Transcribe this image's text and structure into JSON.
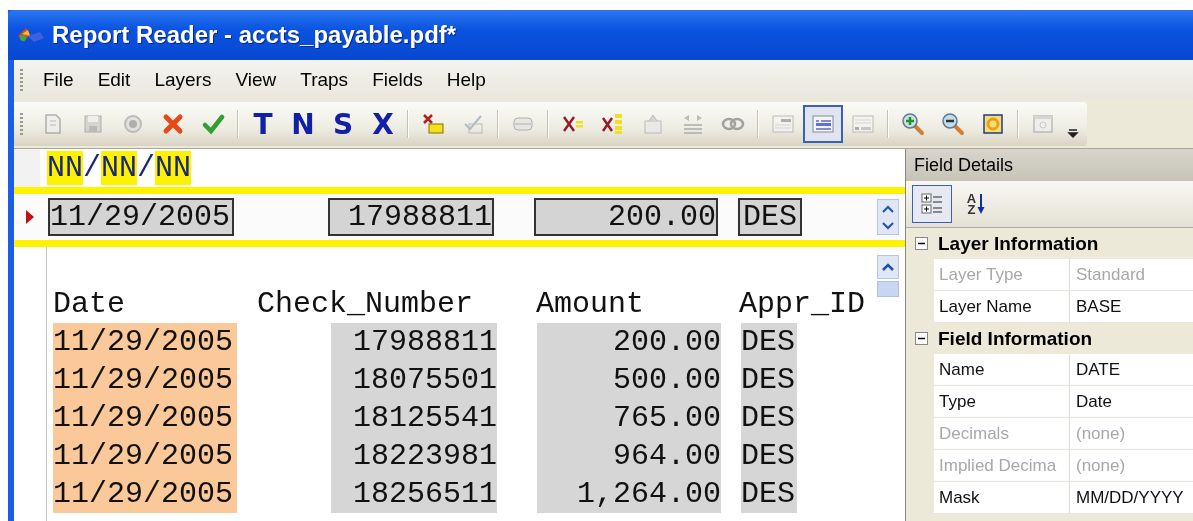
{
  "window": {
    "title": "Report Reader - accts_payable.pdf*"
  },
  "menu": [
    "File",
    "Edit",
    "Layers",
    "View",
    "Traps",
    "Fields",
    "Help"
  ],
  "toolbar": [
    {
      "kind": "page",
      "disabled": true
    },
    {
      "kind": "save",
      "disabled": true
    },
    {
      "kind": "record",
      "disabled": true
    },
    {
      "kind": "cancel",
      "disabled": false
    },
    {
      "kind": "accept",
      "disabled": false
    },
    {
      "kind": "separator"
    },
    {
      "kind": "letter",
      "label": "T",
      "disabled": false
    },
    {
      "kind": "letter",
      "label": "N",
      "disabled": false
    },
    {
      "kind": "letter",
      "label": "S",
      "disabled": false
    },
    {
      "kind": "letter",
      "label": "X",
      "disabled": false
    },
    {
      "kind": "separator"
    },
    {
      "kind": "clear-box",
      "disabled": false
    },
    {
      "kind": "check-box",
      "disabled": true
    },
    {
      "kind": "separator"
    },
    {
      "kind": "stack",
      "disabled": true
    },
    {
      "kind": "separator"
    },
    {
      "kind": "clear-equal",
      "disabled": false
    },
    {
      "kind": "clear-list",
      "disabled": false
    },
    {
      "kind": "upload",
      "disabled": true
    },
    {
      "kind": "arrows",
      "disabled": true
    },
    {
      "kind": "link",
      "disabled": true
    },
    {
      "kind": "separator"
    },
    {
      "kind": "view-top",
      "disabled": true,
      "selected": false
    },
    {
      "kind": "view-list",
      "disabled": false,
      "selected": true
    },
    {
      "kind": "view-bottom",
      "disabled": true,
      "selected": false
    },
    {
      "kind": "separator"
    },
    {
      "kind": "zoom-in",
      "disabled": false
    },
    {
      "kind": "zoom-out",
      "disabled": false
    },
    {
      "kind": "fit",
      "disabled": false
    },
    {
      "kind": "separator"
    },
    {
      "kind": "window",
      "disabled": true
    },
    {
      "kind": "overflow"
    }
  ],
  "mask": [
    {
      "text": "NN",
      "highlighted": true
    },
    {
      "text": "/",
      "highlighted": false
    },
    {
      "text": "NN",
      "highlighted": true
    },
    {
      "text": "/",
      "highlighted": false
    },
    {
      "text": "NN",
      "highlighted": true
    }
  ],
  "template_row": {
    "current": true,
    "cells": [
      "11/29/2005",
      "17988811",
      "200.00",
      "DES"
    ]
  },
  "report": {
    "columns": [
      {
        "name": "Date",
        "selected": true
      },
      {
        "name": "Check_Number",
        "selected": false
      },
      {
        "name": "Amount",
        "selected": false
      },
      {
        "name": "Appr_ID",
        "selected": false
      }
    ],
    "rows": [
      [
        "11/29/2005",
        "17988811",
        "200.00",
        "DES"
      ],
      [
        "11/29/2005",
        "18075501",
        "500.00",
        "DES"
      ],
      [
        "11/29/2005",
        "18125541",
        "765.00",
        "DES"
      ],
      [
        "11/29/2005",
        "18223981",
        "964.00",
        "DES"
      ],
      [
        "11/29/2005",
        "18256511",
        "1,264.00",
        "DES"
      ]
    ]
  },
  "field_details": {
    "title": "Field Details",
    "toolbar": [
      {
        "kind": "categorized",
        "selected": true
      },
      {
        "kind": "alphabetical",
        "selected": false,
        "glyphs": [
          "A",
          "Z"
        ]
      }
    ],
    "categories": [
      {
        "name": "Layer Information",
        "expanded": true,
        "properties": [
          {
            "name": "Layer Type",
            "value": "Standard",
            "disabled": true
          },
          {
            "name": "Layer Name",
            "value": "BASE",
            "disabled": false
          }
        ]
      },
      {
        "name": "Field Information",
        "expanded": true,
        "properties": [
          {
            "name": "Name",
            "value": "DATE",
            "disabled": false
          },
          {
            "name": "Type",
            "value": "Date",
            "disabled": false
          },
          {
            "name": "Decimals",
            "value": "(none)",
            "disabled": true
          },
          {
            "name": "Implied Decima",
            "value": "(none)",
            "disabled": true
          },
          {
            "name": "Mask",
            "value": "MM/DD/YYYY",
            "disabled": false
          }
        ]
      }
    ]
  }
}
